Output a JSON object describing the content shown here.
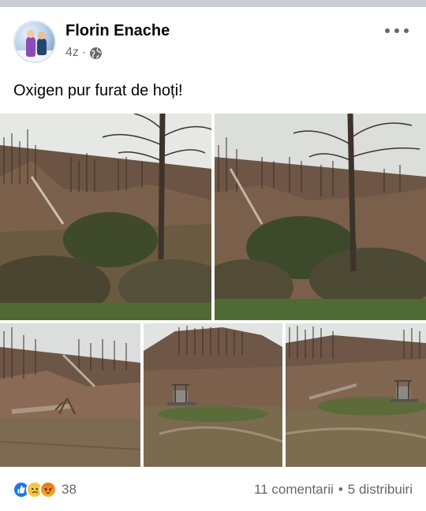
{
  "post": {
    "author": "Florin Enache",
    "timestamp": "4z",
    "separator": "·",
    "privacy_icon": "globe-icon",
    "text": "Oxigen pur furat de hoți!"
  },
  "photos": [
    {
      "name": "photo-1",
      "subject": "deforested hillside with bare tree"
    },
    {
      "name": "photo-2",
      "subject": "deforested hillside with bare tree"
    },
    {
      "name": "photo-3",
      "subject": "felled tree stumps"
    },
    {
      "name": "photo-4",
      "subject": "cleared valley with well"
    },
    {
      "name": "photo-5",
      "subject": "cleared valley with well"
    }
  ],
  "footer": {
    "reaction_icons": [
      "like-icon",
      "sad-icon",
      "angry-icon"
    ],
    "reaction_count": "38",
    "comments": "11 comentarii",
    "dot": "•",
    "shares": "5 distribuiri"
  },
  "colors": {
    "secondary_text": "#65676b",
    "like_blue": "#1877f2",
    "sad_yellow": "#f7c53a",
    "angry_orange": "#e9710f"
  }
}
